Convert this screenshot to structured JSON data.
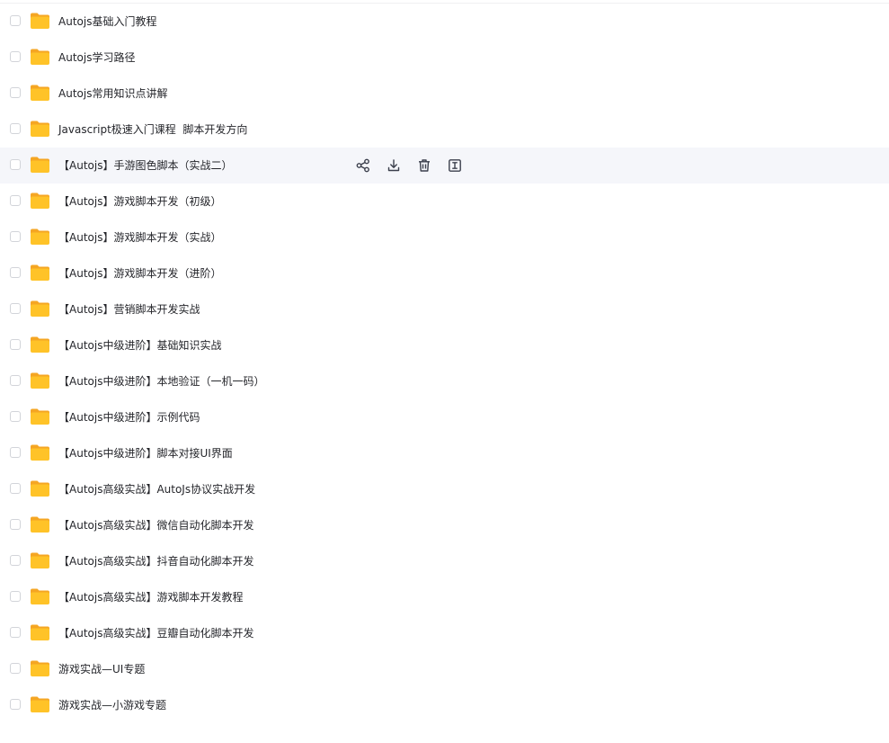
{
  "files": [
    {
      "name": "Autojs基础入门教程"
    },
    {
      "name": "Autojs学习路径"
    },
    {
      "name": "Autojs常用知识点讲解"
    },
    {
      "name": "Javascript极速入门课程  脚本开发方向"
    },
    {
      "name": "【Autojs】手游图色脚本（实战二）",
      "hovered": true
    },
    {
      "name": "【Autojs】游戏脚本开发（初级）"
    },
    {
      "name": "【Autojs】游戏脚本开发（实战）"
    },
    {
      "name": "【Autojs】游戏脚本开发（进阶）"
    },
    {
      "name": "【Autojs】营销脚本开发实战"
    },
    {
      "name": "【Autojs中级进阶】基础知识实战"
    },
    {
      "name": "【Autojs中级进阶】本地验证（一机一码）"
    },
    {
      "name": "【Autojs中级进阶】示例代码"
    },
    {
      "name": "【Autojs中级进阶】脚本对接UI界面"
    },
    {
      "name": "【Autojs高级实战】AutoJs协议实战开发"
    },
    {
      "name": "【Autojs高级实战】微信自动化脚本开发"
    },
    {
      "name": "【Autojs高级实战】抖音自动化脚本开发"
    },
    {
      "name": "【Autojs高级实战】游戏脚本开发教程"
    },
    {
      "name": "【Autojs高级实战】豆瓣自动化脚本开发"
    },
    {
      "name": "游戏实战—UI专题"
    },
    {
      "name": "游戏实战—小游戏专题"
    }
  ],
  "hover_actions": [
    {
      "icon": "share-icon",
      "name": "share-button"
    },
    {
      "icon": "download-icon",
      "name": "download-button"
    },
    {
      "icon": "trash-icon",
      "name": "delete-button"
    },
    {
      "icon": "rename-icon",
      "name": "rename-button"
    }
  ],
  "colors": {
    "folder_body": "#FFC328",
    "folder_back": "#F5A623",
    "hover_row": "#f5f6fa",
    "text": "#25262b",
    "action_icon": "#3b3f4c"
  }
}
